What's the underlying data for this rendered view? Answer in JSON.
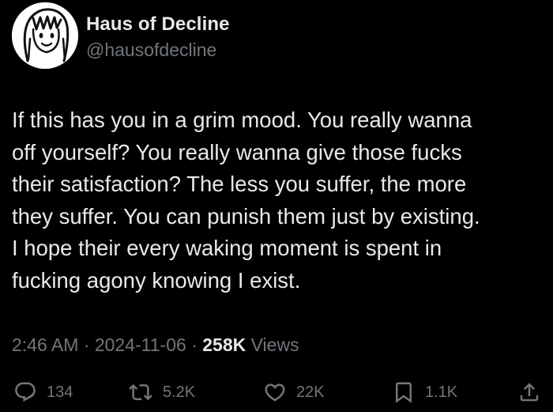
{
  "author": {
    "display_name": "Haus of Decline",
    "handle": "@hausofdecline",
    "avatar_icon": "cartoon-face-avatar"
  },
  "tweet": {
    "text": "If this has you in a grim mood. You really wanna\noff yourself? You really wanna give those fucks\ntheir satisfaction? The less you suffer, the more\nthey suffer. You can punish them just by existing.\nI hope their every waking moment is spent in\nfucking agony knowing I exist."
  },
  "meta": {
    "time": "2:46 AM",
    "separator": "·",
    "date": "2024-11-06",
    "views_count": "258K",
    "views_label": "Views"
  },
  "actions": {
    "reply": {
      "icon": "reply-icon",
      "count": "134"
    },
    "repost": {
      "icon": "repost-icon",
      "count": "5.2K"
    },
    "like": {
      "icon": "heart-icon",
      "count": "22K"
    },
    "bookmark": {
      "icon": "bookmark-icon",
      "count": "1.1K"
    },
    "share": {
      "icon": "share-icon"
    }
  },
  "colors": {
    "background": "#000000",
    "primary_text": "#e7e9ea",
    "secondary_text": "#71767b"
  }
}
